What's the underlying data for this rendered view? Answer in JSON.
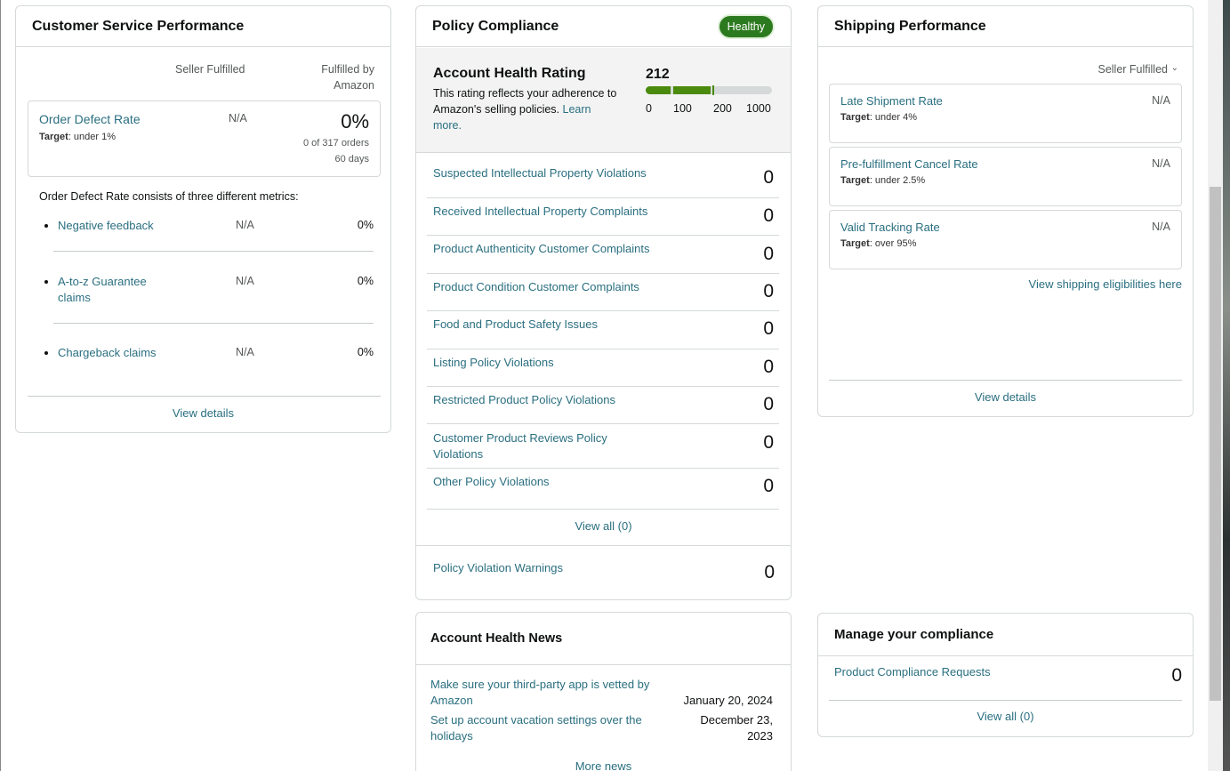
{
  "csp": {
    "title": "Customer Service Performance",
    "col_seller": "Seller Fulfilled",
    "col_amazon_1": "Fulfilled by",
    "col_amazon_2": "Amazon",
    "odr": {
      "label": "Order Defect Rate",
      "target_label": "Target",
      "target_value": ": under 1%",
      "seller": "N/A",
      "amazon": "0%",
      "orders": "0 of 317 orders",
      "days": "60 days"
    },
    "consists_text": "Order Defect Rate consists of three different metrics:",
    "metrics": [
      {
        "label": "Negative feedback",
        "seller": "N/A",
        "amazon": "0%"
      },
      {
        "label_1": "A-to-z Guarantee",
        "label_2": "claims",
        "seller": "N/A",
        "amazon": "0%"
      },
      {
        "label": "Chargeback claims",
        "seller": "N/A",
        "amazon": "0%"
      }
    ],
    "view_details": "View details"
  },
  "pc": {
    "title": "Policy Compliance",
    "badge": "Healthy",
    "ahr_title": "Account Health Rating",
    "ahr_desc_1": "This rating reflects your adherence to",
    "ahr_desc_2": "Amazon's selling policies.",
    "ahr_learn_1": "Learn",
    "ahr_learn_2": "more.",
    "score": "212",
    "score_value": 212,
    "scale": [
      "0",
      "100",
      "200",
      "1000"
    ],
    "rows": [
      {
        "label": "Suspected Intellectual Property Violations",
        "value": "0"
      },
      {
        "label": "Received Intellectual Property Complaints",
        "value": "0"
      },
      {
        "label": "Product Authenticity Customer Complaints",
        "value": "0"
      },
      {
        "label": "Product Condition Customer Complaints",
        "value": "0"
      },
      {
        "label": "Food and Product Safety Issues",
        "value": "0"
      },
      {
        "label": "Listing Policy Violations",
        "value": "0"
      },
      {
        "label": "Restricted Product Policy Violations",
        "value": "0"
      },
      {
        "label": "Customer Product Reviews Policy Violations",
        "value": "0"
      },
      {
        "label": "Other Policy Violations",
        "value": "0"
      }
    ],
    "view_all": "View all (0)",
    "warnings_label": "Policy Violation Warnings",
    "warnings_value": "0"
  },
  "sp": {
    "title": "Shipping Performance",
    "dropdown": "Seller Fulfilled",
    "boxes": [
      {
        "label": "Late Shipment Rate",
        "target_label": "Target",
        "target_value": ": under 4%",
        "value": "N/A"
      },
      {
        "label": "Pre-fulfillment Cancel Rate",
        "target_label": "Target",
        "target_value": ": under 2.5%",
        "value": "N/A"
      },
      {
        "label": "Valid Tracking Rate",
        "target_label": "Target",
        "target_value": ": over 95%",
        "value": "N/A"
      }
    ],
    "eligibilities": "View shipping eligibilities here",
    "view_details": "View details"
  },
  "news": {
    "title": "Account Health News",
    "items": [
      {
        "text_1": "Make sure your third-party app is vetted by",
        "text_2": "Amazon",
        "date_1": "January 20, 2024",
        "date_2": ""
      },
      {
        "text_1": "Set up account vacation settings over the",
        "text_2": "holidays",
        "date_1": "December 23,",
        "date_2": "2023"
      }
    ],
    "more": "More news"
  },
  "mc": {
    "title": "Manage your compliance",
    "row_label": "Product Compliance Requests",
    "row_value": "0",
    "view_all": "View all (0)"
  },
  "colors": {
    "link": "#2a6f80",
    "healthy": "#2c7a1f",
    "bar_green": "#4a8a0c",
    "bar_grey": "#d5d9d9"
  }
}
